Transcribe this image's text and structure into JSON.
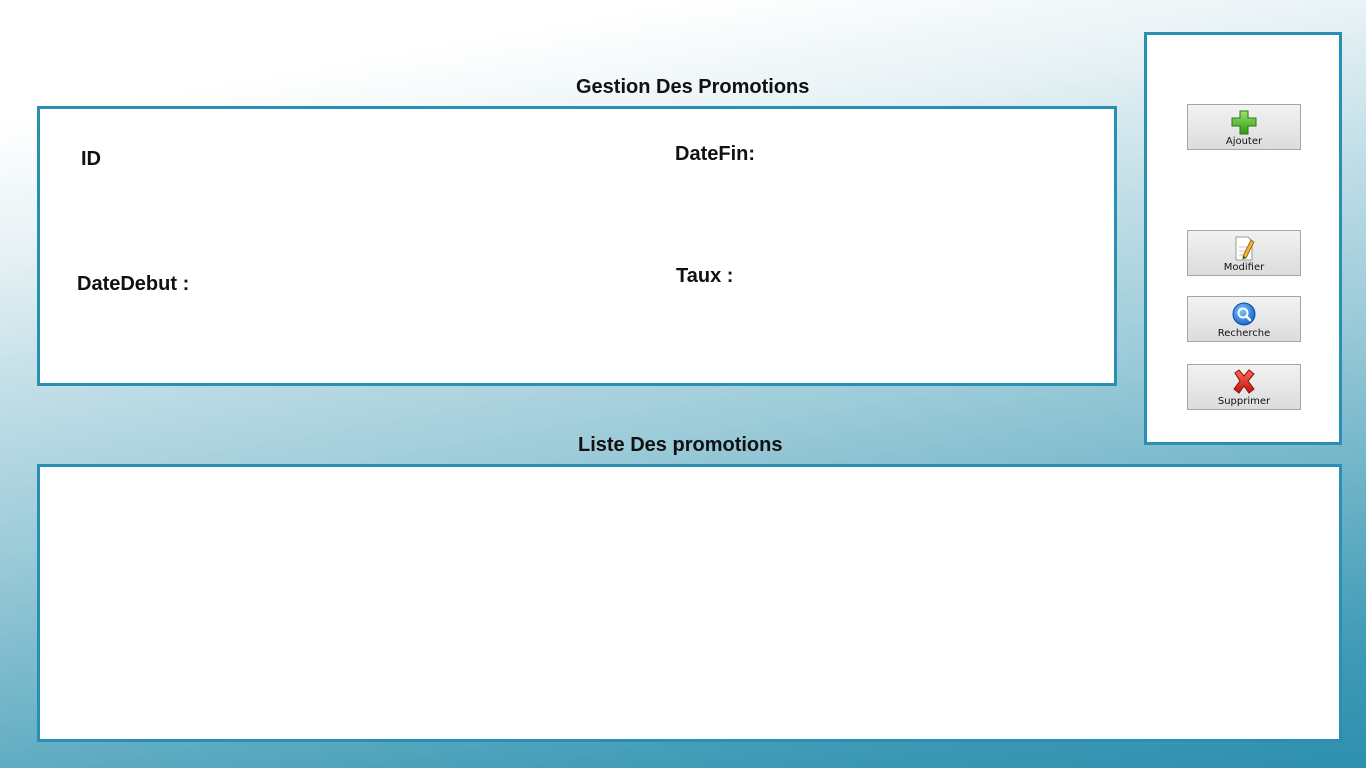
{
  "form": {
    "title": "Gestion Des Promotions",
    "fields": {
      "id_label": "ID",
      "datefin_label": "DateFin:",
      "datedebut_label": "DateDebut :",
      "taux_label": "Taux :"
    }
  },
  "actions": {
    "add_label": "Ajouter",
    "add_icon": "plus-icon",
    "edit_label": "Modifier",
    "edit_icon": "pencil-document-icon",
    "search_label": "Recherche",
    "search_icon": "magnifier-icon",
    "delete_label": "Supprimer",
    "delete_icon": "cross-icon"
  },
  "list": {
    "title": "Liste Des promotions",
    "rows": []
  },
  "colors": {
    "panel_border": "#2a90b3",
    "background_bottom": "#2d8fae"
  }
}
